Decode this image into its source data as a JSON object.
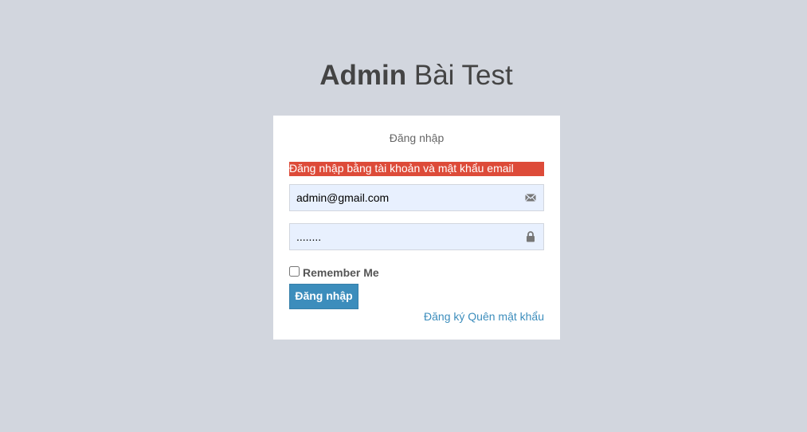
{
  "logo": {
    "bold": "Admin",
    "rest": " Bài Test"
  },
  "login": {
    "box_message": "Đăng nhập",
    "error": "Đăng nhập bằng tài khoản và mật khẩu email",
    "email_value": "admin@gmail.com",
    "password_value": "........",
    "email_icon": "envelope-icon",
    "password_icon": "lock-icon",
    "remember_label": "Remember Me",
    "remember_checked": false,
    "submit_label": "Đăng nhập",
    "register_link": "Đăng ký",
    "forgot_link": "Quên mật khẩu"
  },
  "colors": {
    "page_background": "#d2d6de",
    "button_primary": "#3c8dbc",
    "error_bar": "#dd4b39",
    "field_autofill": "#e8f0fe"
  }
}
